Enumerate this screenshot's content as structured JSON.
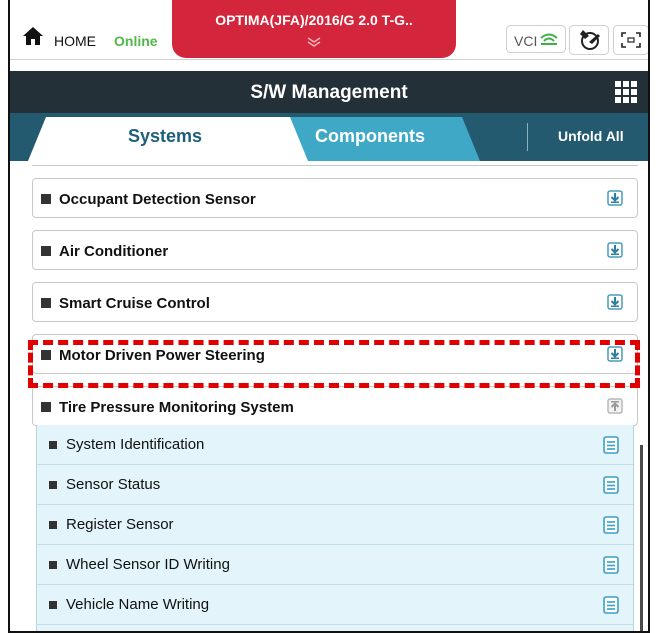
{
  "topbar": {
    "home_label": "HOME",
    "online_label": "Online",
    "vehicle": "OPTIMA(JFA)/2016/G 2.0 T-G..",
    "vci_label": "VCI",
    "icons": [
      "home-icon",
      "chevron-down-icon",
      "wifi-icon",
      "tools-icon",
      "fullscreen-icon"
    ]
  },
  "titlebar": {
    "title": "S/W Management"
  },
  "tabs": {
    "systems": "Systems",
    "components": "Components",
    "unfold_all": "Unfold All",
    "active": "Systems"
  },
  "systems": [
    {
      "label": "Occupant Detection Sensor",
      "state": "collapsed"
    },
    {
      "label": "Air Conditioner",
      "state": "collapsed"
    },
    {
      "label": "Smart Cruise Control",
      "state": "collapsed"
    },
    {
      "label": "Motor Driven Power Steering",
      "state": "collapsed"
    },
    {
      "label": "Tire Pressure Monitoring System",
      "state": "expanded"
    }
  ],
  "sub_items": [
    {
      "label": "System Identification"
    },
    {
      "label": "Sensor Status"
    },
    {
      "label": "Register Sensor",
      "highlighted": true
    },
    {
      "label": "Wheel Sensor ID Writing"
    },
    {
      "label": "Vehicle Name Writing"
    }
  ],
  "colors": {
    "vehicle_tab": "#d3253b",
    "titlebar": "#243037",
    "tabbar": "#245a70",
    "active_tab_text": "#1f5f7a",
    "inactive_tab": "#3fa8c6",
    "online": "#52b84a",
    "highlight": "#e10000",
    "sub_panel": "#e3f5fa",
    "doc_icon": "#3b9fc6"
  }
}
